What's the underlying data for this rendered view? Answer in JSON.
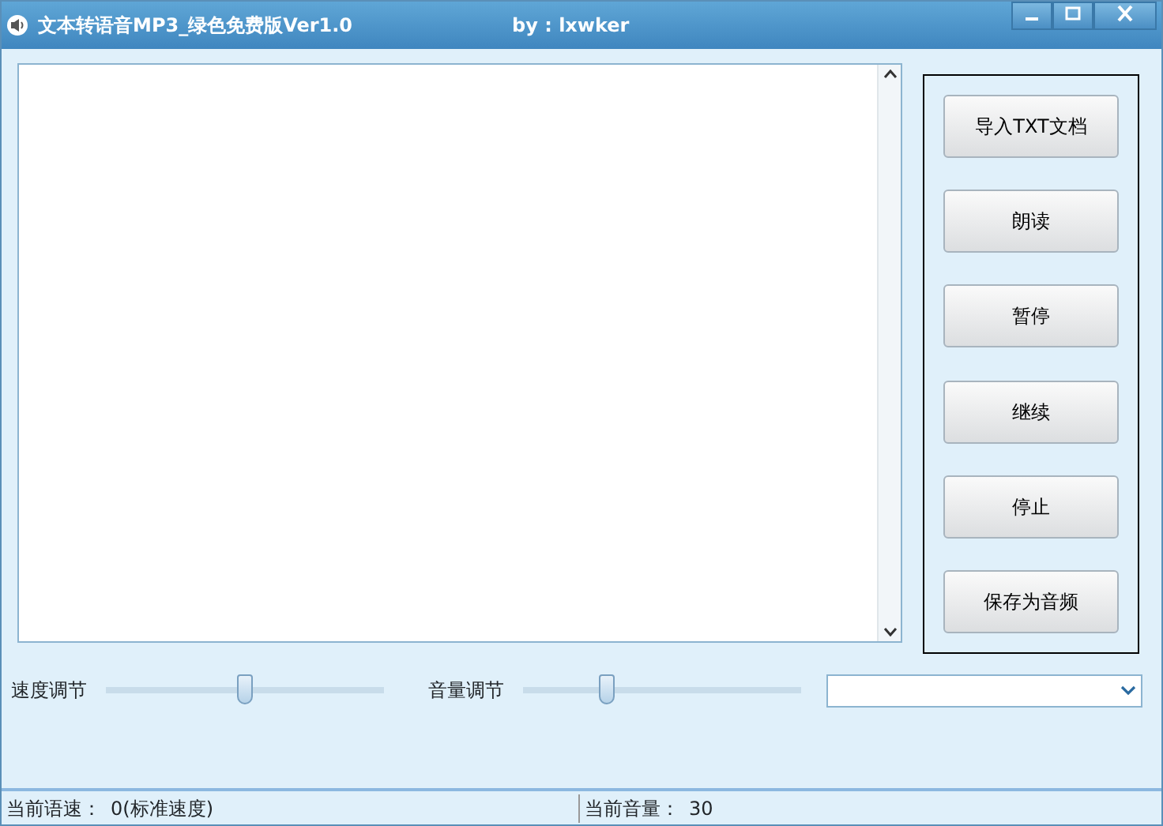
{
  "window": {
    "title": "文本转语音MP3_绿色免费版Ver1.0",
    "author": "by : lxwker"
  },
  "buttons": [
    "导入TXT文档",
    "朗读",
    "暂停",
    "继续",
    "停止",
    "保存为音频"
  ],
  "sliders": [
    {
      "label": "速度调节",
      "level": 0.5
    },
    {
      "label": "音量调节",
      "level": 0.3
    }
  ],
  "status_bar": [
    {
      "label": "当前语速：",
      "value": "0(标准速度)"
    },
    {
      "label": "当前音量：",
      "value": "30"
    }
  ]
}
